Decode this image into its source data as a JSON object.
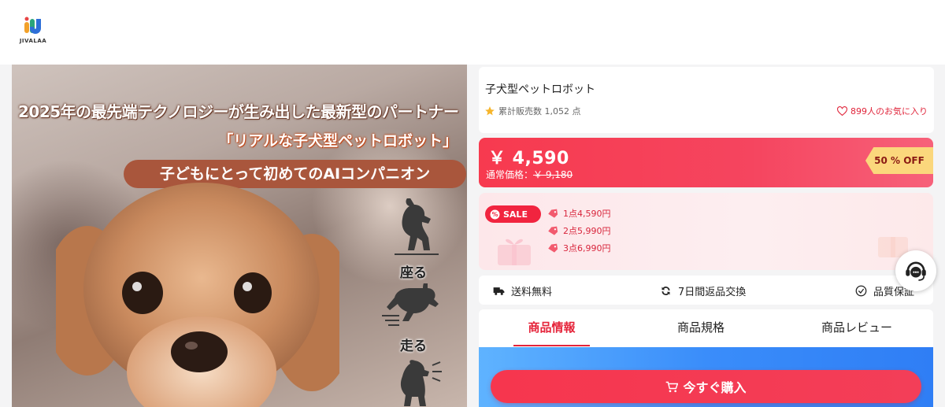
{
  "brand": {
    "logo_text": "JIVALAA"
  },
  "hero": {
    "headline": "2025年の最先端テクノロジーが生み出した最新型のパートナー",
    "subheadline": "「リアルな子犬型ペットロボット」",
    "pill_text": "子どもにとって初めてのAIコンパニオン",
    "actions": [
      "座る",
      "走る"
    ]
  },
  "product": {
    "title": "子犬型ペットロボット",
    "sold_label": "累計販売数 1,052 点",
    "favorites_label": "899人のお気に入り",
    "price": "￥ 4,590",
    "original_price_label": "通常価格：",
    "original_price": "￥ 9,180",
    "discount_badge": "50 % OFF"
  },
  "sale": {
    "badge": "SALE",
    "tiers": [
      "1点4,590円",
      "2点5,990円",
      "3点6,990円"
    ]
  },
  "services": [
    "送料無料",
    "7日間返品交換",
    "品質保証"
  ],
  "tabs": [
    "商品情報",
    "商品規格",
    "商品レビュー"
  ],
  "buy_button": {
    "label": "今すぐ購入"
  },
  "colors": {
    "accent": "#f33e58",
    "badge_yellow": "#fbd77c",
    "sale_bg": "#fde7ea"
  }
}
